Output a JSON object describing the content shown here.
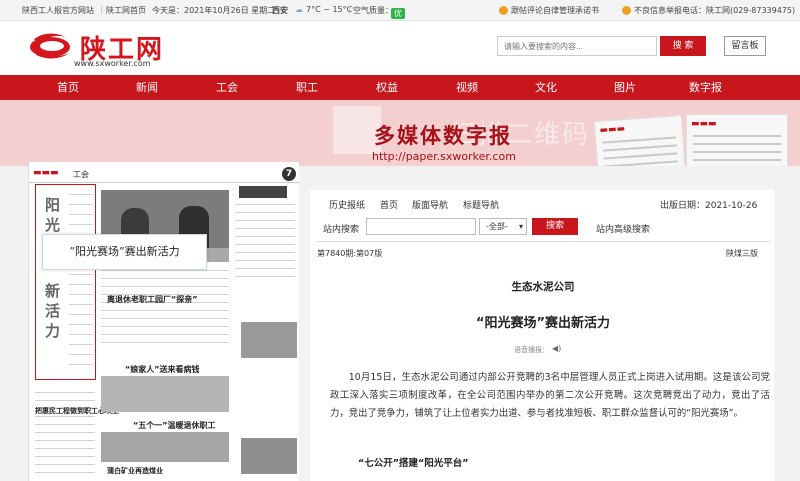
{
  "topbar": {
    "site_name": "陕西工人报官方网站",
    "home_link": "陕工网首页",
    "date": "今天是：2021年10月26日 星期二",
    "city": "西安",
    "weather": "7°C ~ 15°C",
    "air_label": "空气质量：",
    "air_value": "优",
    "pledge": "跟帖评论自律管理承诺书",
    "report_phone": "不良信息举报电话：陕工网(029-87339475)"
  },
  "header": {
    "logo_text": "陕工网",
    "logo_url": "www.sxworker.com",
    "search_placeholder": "请输入要搜索的内容...",
    "search_button": "搜 索",
    "guestbook_button": "留言板"
  },
  "nav": [
    "首页",
    "新闻",
    "工会",
    "职工",
    "权益",
    "视频",
    "文化",
    "图片",
    "数字报"
  ],
  "banner": {
    "title": "多媒体数字报",
    "url": "http://paper.sxworker.com",
    "watermark": "扫描二维码 看报更方便"
  },
  "paper_panel": {
    "section": "工会",
    "page_number": "7",
    "tooltip": "“阳光赛场”赛出新活力",
    "headlines": [
      "离退休老职工园厂“探亲”",
      "“娘家人”送来看病钱",
      "“五个一”温暖退休职工",
      "把惠民工程做到职工心坎上",
      "蒲白矿业再造煤业"
    ]
  },
  "main": {
    "toolbar": [
      "历史报纸",
      "首页",
      "版面导航",
      "标题导航"
    ],
    "publish_date": "出版日期：2021-10-26",
    "site_search_label": "站内搜索",
    "select_value": "-全部-",
    "search_button": "搜索",
    "advanced_search": "站内高级搜索",
    "issue": "第7840期:第07版",
    "edition": "陕煤三版",
    "company": "生态水泥公司",
    "title": "“阳光赛场”赛出新活力",
    "voice_label": "语音播报：",
    "paragraph": "10月15日，生态水泥公司通过内部公开竞聘的3名中层管理人员正式上岗进入试用期。这是该公司党政工深入落实三项制度改革，在全公司范围内举办的第二次公开竞聘。这次竞聘竞出了动力，竞出了活力，竞出了竞争力，铺筑了让上位者实力出道、参与者找准短板、职工群众监督认可的“阳光赛场”。",
    "subheading": "“七公开”搭建“阳光平台”"
  },
  "colors": {
    "brand_red": "#c8161d"
  }
}
